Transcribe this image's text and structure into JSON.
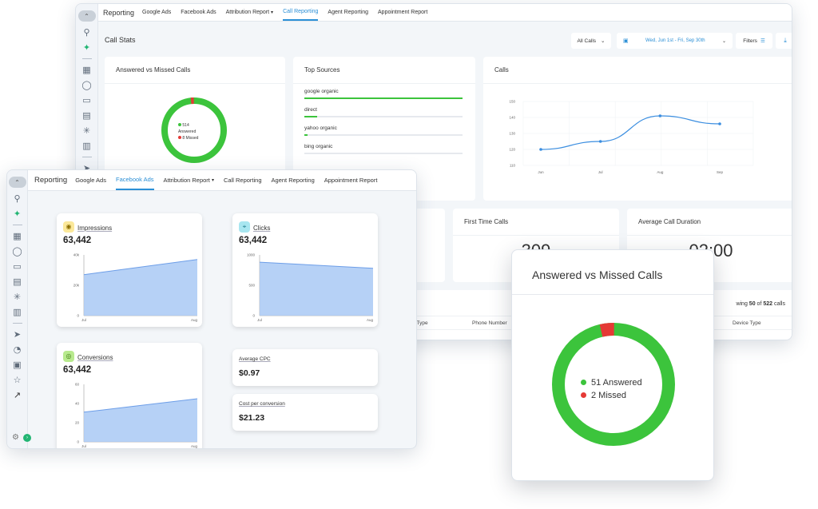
{
  "back_window": {
    "nav": {
      "title": "Reporting",
      "tabs": [
        "Google Ads",
        "Facebook Ads",
        "Attribution Report",
        "Call Reporting",
        "Agent Reporting",
        "Appointment Report"
      ],
      "active_tab": "Call Reporting"
    },
    "header": {
      "title": "Call Stats",
      "all_calls": "All Calls",
      "date_range": "Wed, Jun 1st - Fri, Sep 30th",
      "filters": "Filters"
    },
    "answered_card": {
      "title": "Answered vs Missed Calls",
      "answered_label": "514",
      "answered_text": "Answered",
      "missed_label": "8 Missed",
      "answered": 514,
      "missed": 8
    },
    "top_sources": {
      "title": "Top Sources",
      "items": [
        {
          "name": "google organic",
          "share": 1.0
        },
        {
          "name": "direct",
          "share": 0.08
        },
        {
          "name": "yahoo organic",
          "share": 0.02
        },
        {
          "name": "bing organic",
          "share": 0.0
        }
      ]
    },
    "calls_chart": {
      "title": "Calls",
      "y_ticks": [
        "150",
        "140",
        "130",
        "120",
        "110"
      ],
      "x_ticks": [
        "Jun",
        "Jul",
        "Aug",
        "Sep"
      ]
    },
    "first_time_calls": {
      "title": "First Time Calls",
      "value": "309"
    },
    "avg_duration": {
      "title": "Average Call Duration",
      "value": "02:00"
    },
    "table": {
      "showing_prefix": "wing",
      "showing_count": "50",
      "showing_of": "of",
      "showing_total": "522",
      "showing_suffix": "calls",
      "col_device_type_left": "ce Type",
      "col_phone_number": "Phone Number",
      "col_device_type": "Device Type"
    }
  },
  "front_window": {
    "nav": {
      "title": "Reporting",
      "tabs": [
        "Google Ads",
        "Facebook Ads",
        "Attribution Report",
        "Call Reporting",
        "Agent Reporting",
        "Appointment Report"
      ],
      "active_tab": "Facebook Ads"
    },
    "impressions": {
      "label": "Impressions",
      "value": "63,442",
      "y_ticks": [
        "40k",
        "20k",
        "0"
      ],
      "x_ticks": [
        "Jul",
        "Aug"
      ]
    },
    "clicks": {
      "label": "Clicks",
      "value": "63,442",
      "y_ticks": [
        "1000",
        "500",
        "0"
      ],
      "x_ticks": [
        "Jul",
        "Aug"
      ]
    },
    "conversions": {
      "label": "Conversions",
      "value": "63,442",
      "y_ticks": [
        "60",
        "40",
        "20",
        "0"
      ],
      "x_ticks": [
        "Jul",
        "Aug"
      ]
    },
    "avg_cpc": {
      "label": "Average CPC",
      "value": "$0.97"
    },
    "cost_per_conversion": {
      "label": "Cost per conversion",
      "value": "$21.23"
    }
  },
  "popup": {
    "title": "Answered vs Missed Calls",
    "answered_text": "51 Answered",
    "missed_text": "2 Missed",
    "answered": 51,
    "missed": 2
  },
  "chart_data": [
    {
      "type": "line",
      "title": "Calls",
      "categories": [
        "Jun",
        "Jul",
        "Aug",
        "Sep"
      ],
      "values": [
        120,
        125,
        141,
        136
      ],
      "ylim": [
        110,
        150
      ]
    },
    {
      "type": "pie",
      "title": "Answered vs Missed Calls",
      "categories": [
        "Answered",
        "Missed"
      ],
      "values": [
        51,
        2
      ]
    },
    {
      "type": "area",
      "title": "Impressions",
      "categories": [
        "Jul",
        "Aug"
      ],
      "values": [
        27000,
        37000
      ],
      "ylim": [
        0,
        40000
      ]
    },
    {
      "type": "area",
      "title": "Clicks",
      "categories": [
        "Jul",
        "Aug"
      ],
      "values": [
        880,
        780
      ],
      "ylim": [
        0,
        1000
      ]
    },
    {
      "type": "area",
      "title": "Conversions",
      "categories": [
        "Jul",
        "Aug"
      ],
      "values": [
        31,
        45
      ],
      "ylim": [
        0,
        60
      ]
    }
  ],
  "colors": {
    "accent": "#2b8fd6",
    "answered": "#3cc43c",
    "missed": "#e53935",
    "area_fill": "#a9c9f5",
    "area_line": "#6d9ee8",
    "line": "#3b8ee0"
  }
}
